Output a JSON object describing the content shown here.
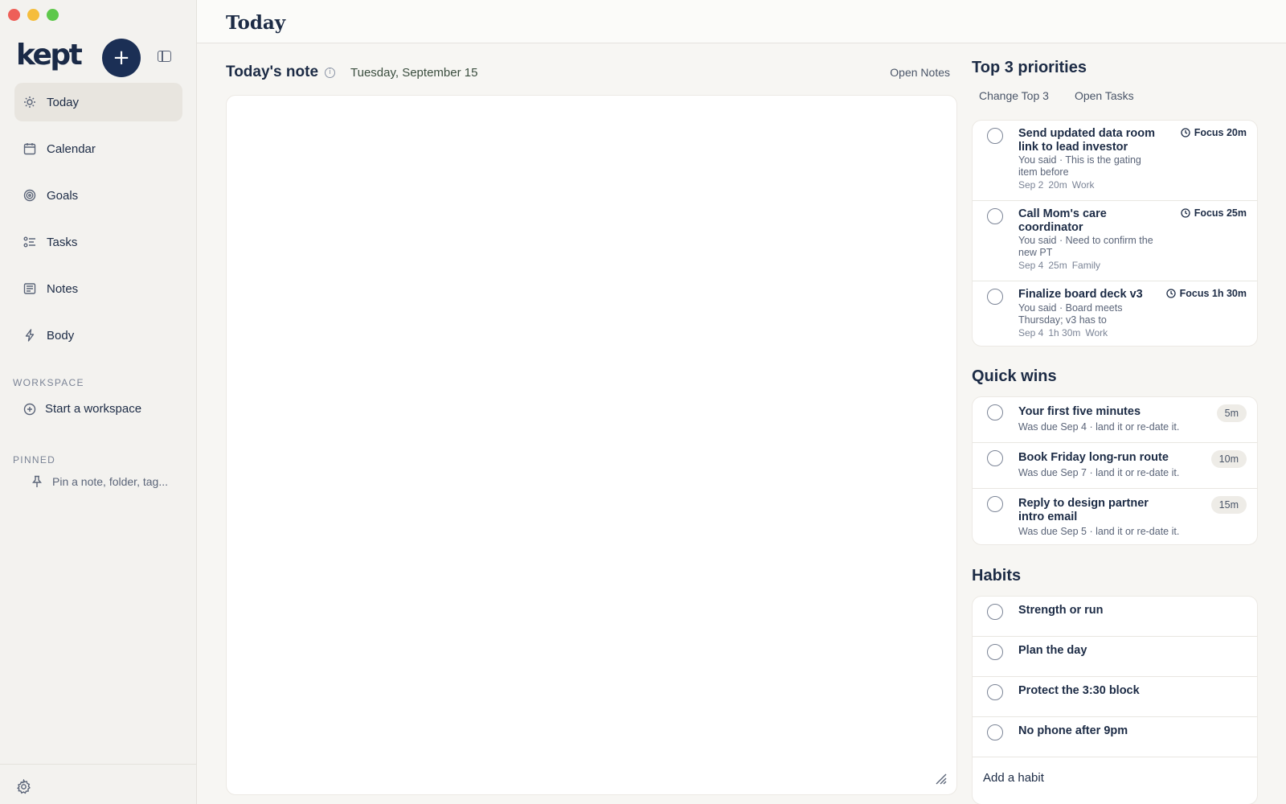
{
  "app": {
    "name": "kept"
  },
  "sidebar": {
    "add_label": "+",
    "nav": [
      {
        "label": "Today",
        "icon": "sun-icon"
      },
      {
        "label": "Calendar",
        "icon": "calendar-icon"
      },
      {
        "label": "Goals",
        "icon": "target-icon"
      },
      {
        "label": "Tasks",
        "icon": "tasks-icon"
      },
      {
        "label": "Notes",
        "icon": "notes-icon"
      },
      {
        "label": "Body",
        "icon": "bolt-icon"
      }
    ],
    "workspace_label": "WORKSPACE",
    "workspace_item": "Start a workspace",
    "pinned_label": "PINNED",
    "pinned_item": "Pin a note, folder, tag..."
  },
  "header": {
    "title": "Today"
  },
  "note": {
    "title": "Today's note",
    "info": "i",
    "date": "Tuesday, September 15",
    "open_label": "Open Notes"
  },
  "priorities": {
    "title": "Top 3 priorities",
    "change_label": "Change Top 3",
    "open_tasks_label": "Open Tasks",
    "items": [
      {
        "title_1": "Send updated data room",
        "title_2": "link to lead investor",
        "sub_1": "You said · This is the gating",
        "sub_2": "item before",
        "date": "Sep 2",
        "duration": "20m",
        "tag": "Work",
        "focus": "Focus 20m"
      },
      {
        "title_1": "Call Mom's care",
        "title_2": "coordinator",
        "sub_1": "You said · Need to confirm the",
        "sub_2": "new PT",
        "date": "Sep 4",
        "duration": "25m",
        "tag": "Family",
        "focus": "Focus 25m"
      },
      {
        "title_1": "Finalize board deck v3",
        "sub_1": "You said · Board meets",
        "sub_2": "Thursday; v3 has to",
        "date": "Sep 4",
        "duration": "1h 30m",
        "tag": "Work",
        "focus": "Focus 1h 30m"
      }
    ]
  },
  "quick_wins": {
    "title": "Quick wins",
    "items": [
      {
        "title_1": "Your first five minutes",
        "sub": "Was due Sep 4 · land it or re-date it.",
        "duration": "5m"
      },
      {
        "title_1": "Book Friday long-run route",
        "sub": "Was due Sep 7 · land it or re-date it.",
        "duration": "10m"
      },
      {
        "title_1": "Reply to design partner",
        "title_2": "intro email",
        "sub": "Was due Sep 5 · land it or re-date it.",
        "duration": "15m"
      }
    ]
  },
  "habits": {
    "title": "Habits",
    "items": [
      {
        "title": "Strength or run"
      },
      {
        "title": "Plan the day"
      },
      {
        "title": "Protect the 3:30 block"
      },
      {
        "title": "No phone after 9pm"
      }
    ],
    "add_label": "Add a habit"
  },
  "colors": {
    "accent": "#1b2f55",
    "background": "#f7f6f3",
    "sidebar": "#f3f2ef",
    "text": "#1c2b45"
  }
}
